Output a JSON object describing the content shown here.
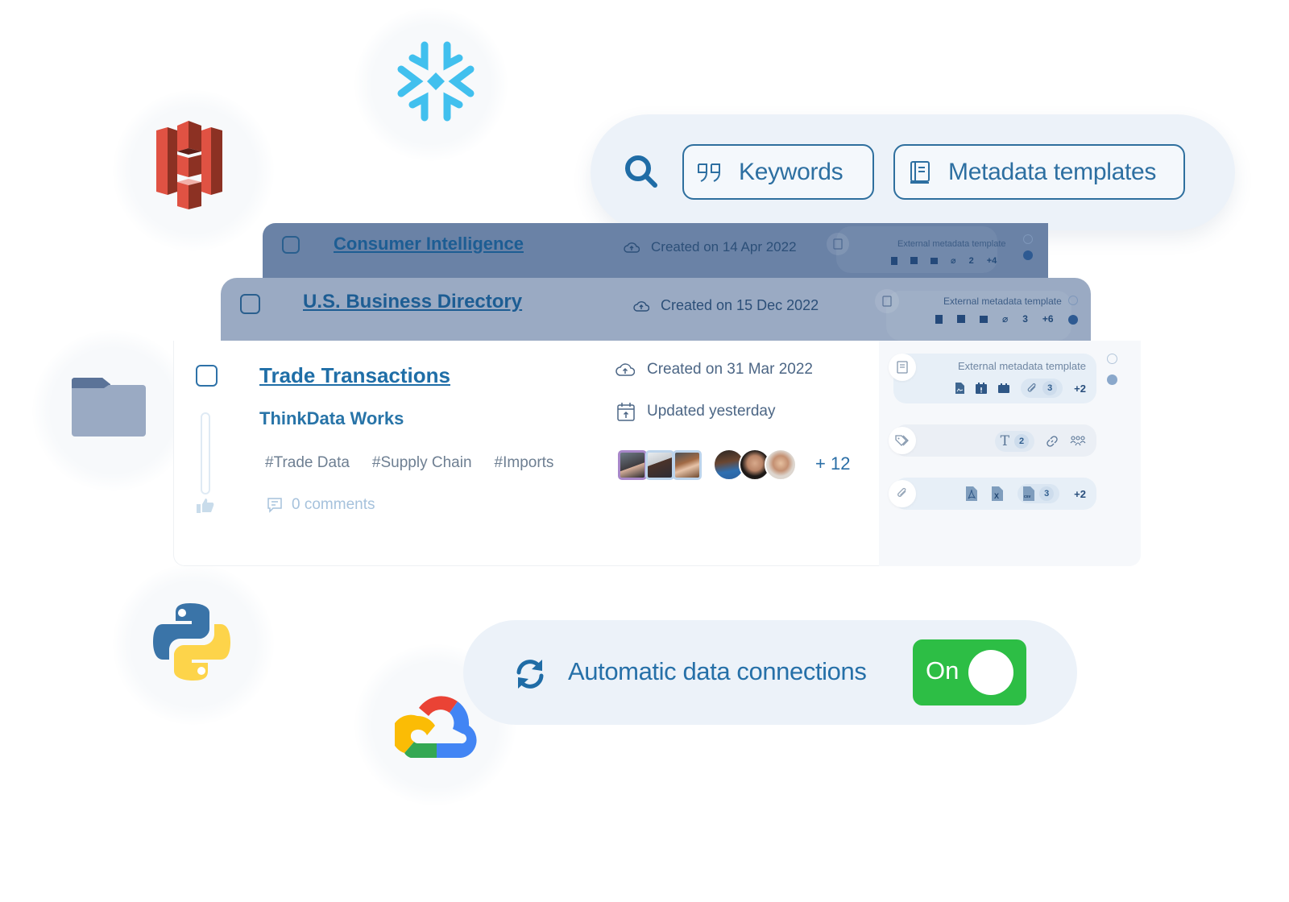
{
  "integrations": [
    {
      "name": "Amazon S3",
      "icon": "amazon-s3-logo"
    },
    {
      "name": "Snowflake",
      "icon": "snowflake-logo"
    },
    {
      "name": "Folder",
      "icon": "folder-icon"
    },
    {
      "name": "Python",
      "icon": "python-logo"
    },
    {
      "name": "Google Cloud",
      "icon": "google-cloud-logo"
    }
  ],
  "search": {
    "icon": "search-icon",
    "filters": [
      {
        "label": "Keywords",
        "icon": "quote-icon"
      },
      {
        "label": "Metadata templates",
        "icon": "book-icon"
      }
    ]
  },
  "datasets": [
    {
      "title": "Consumer Intelligence",
      "created": "Created on 14 Apr 2022",
      "metadata_label": "External metadata template",
      "attachments_count": "2",
      "more": "+4"
    },
    {
      "title": "U.S. Business Directory",
      "created": "Created on 15 Dec 2022",
      "metadata_label": "External metadata template",
      "attachments_count": "3",
      "more": "+6"
    },
    {
      "title": "Trade Transactions",
      "provider": "ThinkData Works",
      "tags": [
        "#Trade Data",
        "#Supply Chain",
        "#Imports"
      ],
      "comments": "0 comments",
      "created": "Created on 31 Mar 2022",
      "updated": "Updated yesterday",
      "members_more": "+ 12",
      "metadata_label": "External metadata template",
      "attachments_count": "3",
      "more": "+2",
      "fields_text_count": "2",
      "files_csv_count": "3",
      "files_more": "+2"
    }
  ],
  "connections": {
    "label": "Automatic data connections",
    "toggle_label": "On",
    "toggle_state": true,
    "toggle_color": "#2dbe45"
  },
  "colors": {
    "accent": "#2670a8",
    "pill_bg": "#ecf2f9"
  }
}
